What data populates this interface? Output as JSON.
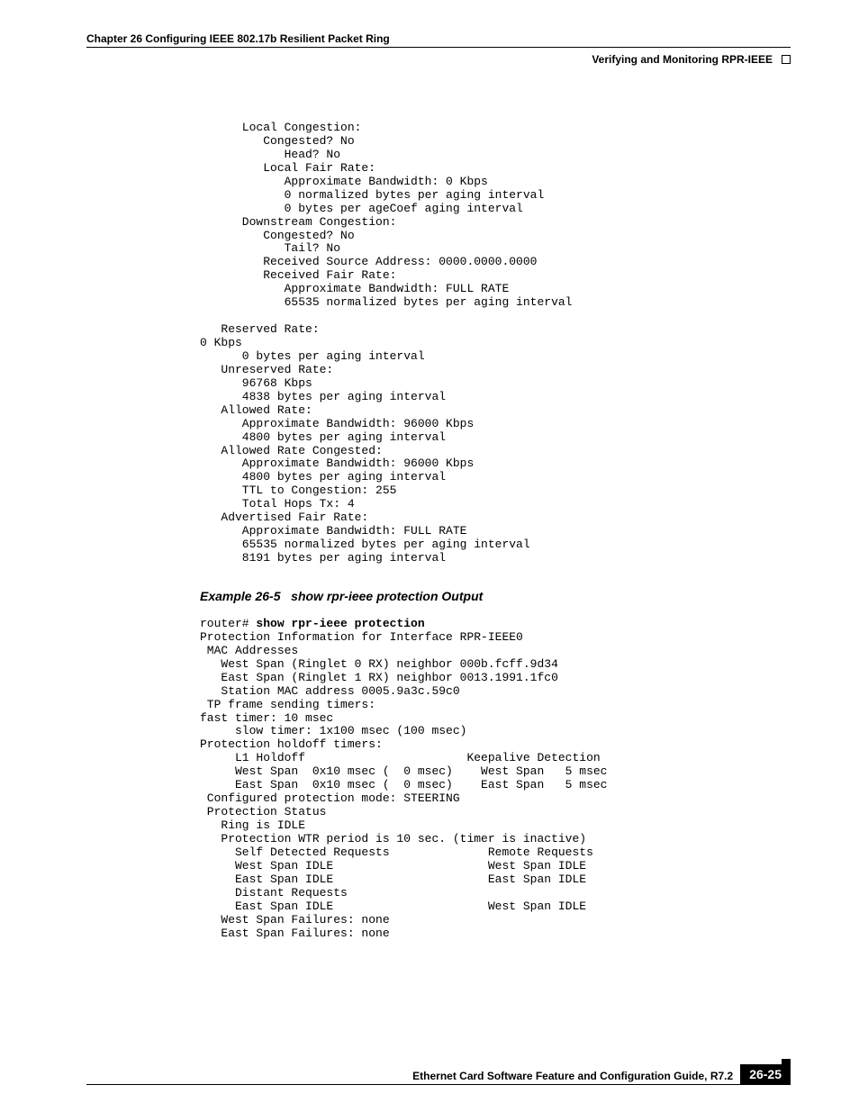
{
  "header": {
    "chapter": "Chapter 26 Configuring IEEE 802.17b Resilient Packet Ring",
    "section": "Verifying and Monitoring RPR-IEEE"
  },
  "block1": "      Local Congestion:\n         Congested? No\n            Head? No\n         Local Fair Rate:\n            Approximate Bandwidth: 0 Kbps\n            0 normalized bytes per aging interval\n            0 bytes per ageCoef aging interval\n      Downstream Congestion:\n         Congested? No\n            Tail? No\n         Received Source Address: 0000.0000.0000\n         Received Fair Rate:\n            Approximate Bandwidth: FULL RATE\n            65535 normalized bytes per aging interval\n\n   Reserved Rate:\n0 Kbps\n      0 bytes per aging interval\n   Unreserved Rate:\n      96768 Kbps\n      4838 bytes per aging interval\n   Allowed Rate:\n      Approximate Bandwidth: 96000 Kbps\n      4800 bytes per aging interval\n   Allowed Rate Congested:\n      Approximate Bandwidth: 96000 Kbps\n      4800 bytes per aging interval\n      TTL to Congestion: 255\n      Total Hops Tx: 4\n   Advertised Fair Rate:\n      Approximate Bandwidth: FULL RATE\n      65535 normalized bytes per aging interval\n      8191 bytes per aging interval",
  "example": {
    "number": "Example 26-5",
    "title": "show rpr-ieee protection Output"
  },
  "cmd": {
    "prompt": "router# ",
    "command": "show rpr-ieee protection"
  },
  "block2": "Protection Information for Interface RPR-IEEE0\n MAC Addresses\n   West Span (Ringlet 0 RX) neighbor 000b.fcff.9d34\n   East Span (Ringlet 1 RX) neighbor 0013.1991.1fc0\n   Station MAC address 0005.9a3c.59c0\n TP frame sending timers:\nfast timer: 10 msec\n     slow timer: 1x100 msec (100 msec)\nProtection holdoff timers:\n     L1 Holdoff                       Keepalive Detection\n     West Span  0x10 msec (  0 msec)    West Span   5 msec\n     East Span  0x10 msec (  0 msec)    East Span   5 msec\n Configured protection mode: STEERING\n Protection Status\n   Ring is IDLE\n   Protection WTR period is 10 sec. (timer is inactive)\n     Self Detected Requests              Remote Requests\n     West Span IDLE                      West Span IDLE\n     East Span IDLE                      East Span IDLE\n     Distant Requests                    \n     East Span IDLE                      West Span IDLE\n   West Span Failures: none\n   East Span Failures: none",
  "footer": {
    "guide": "Ethernet Card Software Feature and Configuration Guide, R7.2",
    "page": "26-25"
  }
}
